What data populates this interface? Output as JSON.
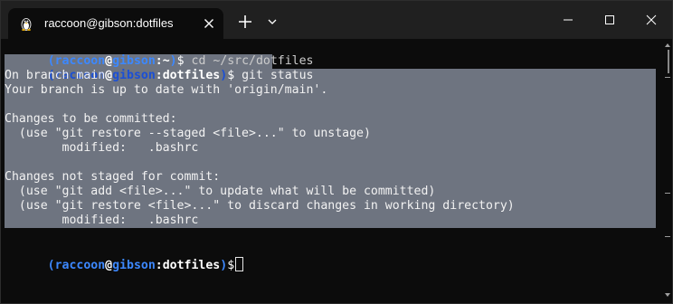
{
  "window": {
    "tab_title": "raccoon@gibson:dotfiles",
    "tab_icon": "linux-penguin-icon",
    "new_tab_label": "+",
    "colors": {
      "titlebar": "#202020",
      "terminal_bg": "#0c0c0c",
      "selection": "#6e7480",
      "prompt_blue": "#3c88ff",
      "text": "#cccccc"
    }
  },
  "terminal": {
    "prompt1": {
      "open": "(",
      "user": "raccoon",
      "at": "@",
      "host": "gibson",
      "colon": ":",
      "cwd": "~",
      "close": ")",
      "dollar": "$",
      "command": " cd ~/src/dotfiles"
    },
    "prompt2": {
      "open": "(",
      "user": "raccoon",
      "at": "@",
      "host": "gibson",
      "colon": ":",
      "cwd": "dotfiles",
      "close": ")",
      "dollar": "$",
      "command": " git status"
    },
    "output": [
      "On branch main",
      "Your branch is up to date with 'origin/main'.",
      "",
      "Changes to be committed:",
      "  (use \"git restore --staged <file>...\" to unstage)",
      "        modified:   .bashrc",
      "",
      "Changes not staged for commit:",
      "  (use \"git add <file>...\" to update what will be committed)",
      "  (use \"git restore <file>...\" to discard changes in working directory)",
      "        modified:   .bashrc"
    ],
    "prompt3": {
      "open": "(",
      "user": "raccoon",
      "at": "@",
      "host": "gibson",
      "colon": ":",
      "cwd": "dotfiles",
      "close": ")",
      "dollar": "$"
    }
  }
}
